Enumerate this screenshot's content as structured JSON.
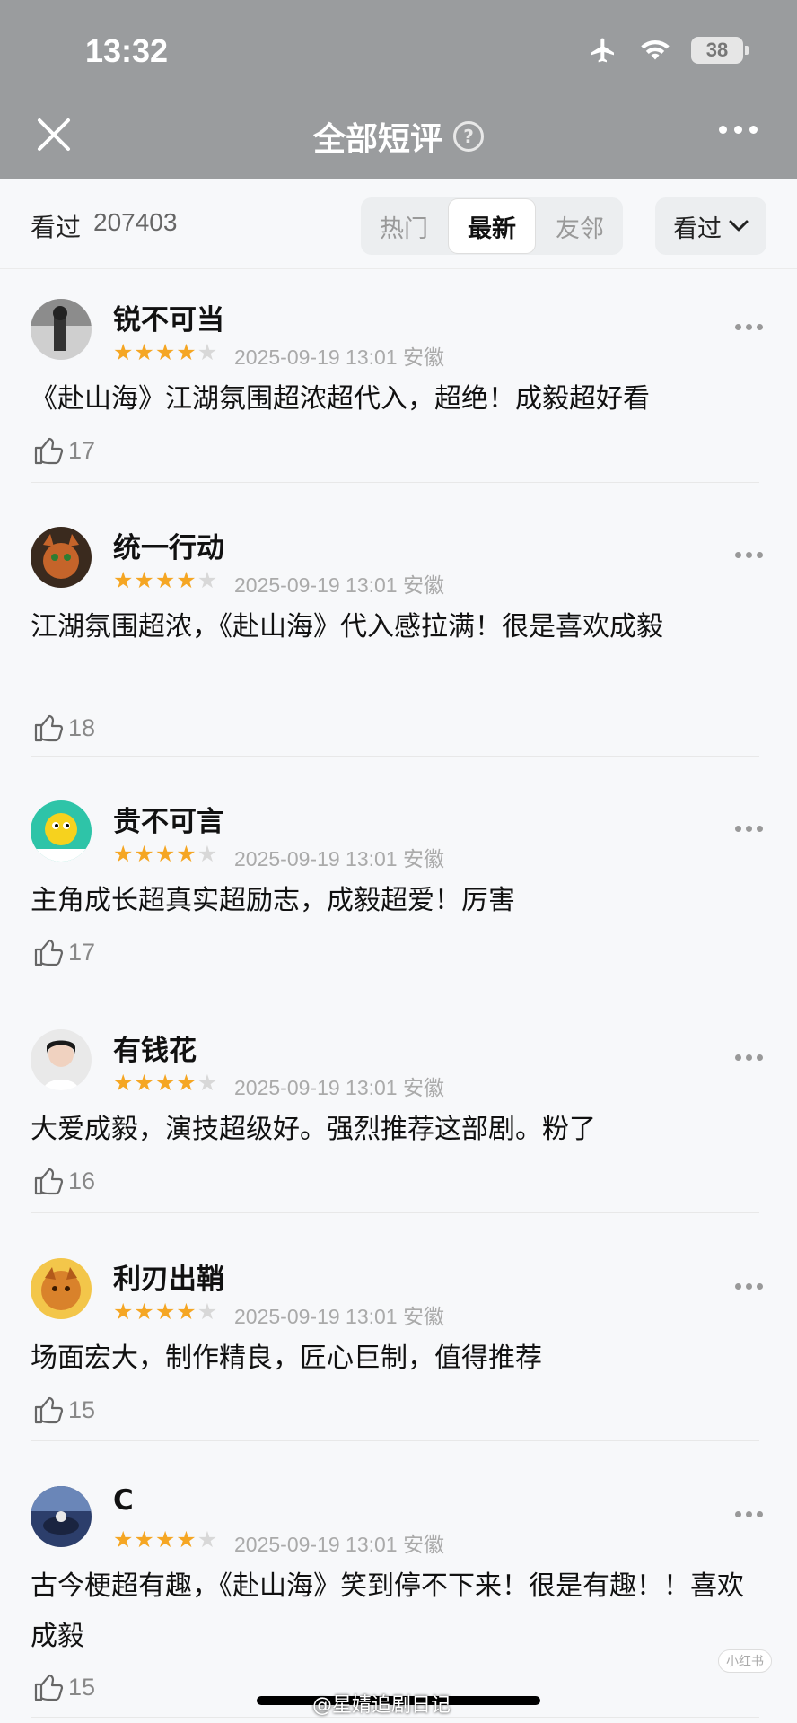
{
  "status_bar": {
    "time": "13:32",
    "battery": "38",
    "icons": [
      "airplane-icon",
      "wifi-icon",
      "battery-icon"
    ]
  },
  "header": {
    "title": "全部短评",
    "help": "?",
    "close_icon": "close-icon",
    "more_icon": "more-icon"
  },
  "filter": {
    "seen_label": "看过",
    "seen_count": "207403",
    "tabs": [
      {
        "label": "热门",
        "active": false
      },
      {
        "label": "最新",
        "active": true
      },
      {
        "label": "友邻",
        "active": false
      }
    ],
    "dropdown_label": "看过"
  },
  "colors": {
    "header_bg": "#9a9c9e",
    "star": "#f5a623",
    "background": "#f7f8fa"
  },
  "reviews": [
    {
      "user": "锐不可当",
      "rating": 4,
      "date": "2025-09-19 13:01",
      "location": "安徽",
      "content": "《赴山海》江湖氛围超浓超代入，超绝！成毅超好看",
      "likes": "17"
    },
    {
      "user": "统一行动",
      "rating": 4,
      "date": "2025-09-19 13:01",
      "location": "安徽",
      "content": "江湖氛围超浓，《赴山海》代入感拉满！很是喜欢成毅",
      "likes": "18"
    },
    {
      "user": "贵不可言",
      "rating": 4,
      "date": "2025-09-19 13:01",
      "location": "安徽",
      "content": "主角成长超真实超励志，成毅超爱！厉害",
      "likes": "17"
    },
    {
      "user": "有钱花",
      "rating": 4,
      "date": "2025-09-19 13:01",
      "location": "安徽",
      "content": "大爱成毅，演技超级好。强烈推荐这部剧。粉了",
      "likes": "16"
    },
    {
      "user": "利刃出鞘",
      "rating": 4,
      "date": "2025-09-19 13:01",
      "location": "安徽",
      "content": "场面宏大，制作精良，匠心巨制，值得推荐",
      "likes": "15"
    },
    {
      "user": "C",
      "rating": 4,
      "date": "2025-09-19 13:01",
      "location": "安徽",
      "content": "古今梗超有趣，《赴山海》笑到停不下来！很是有趣！！喜欢成毅",
      "likes": "15"
    }
  ],
  "watermark": "@星婧追剧日记",
  "float_badge": "小红书"
}
